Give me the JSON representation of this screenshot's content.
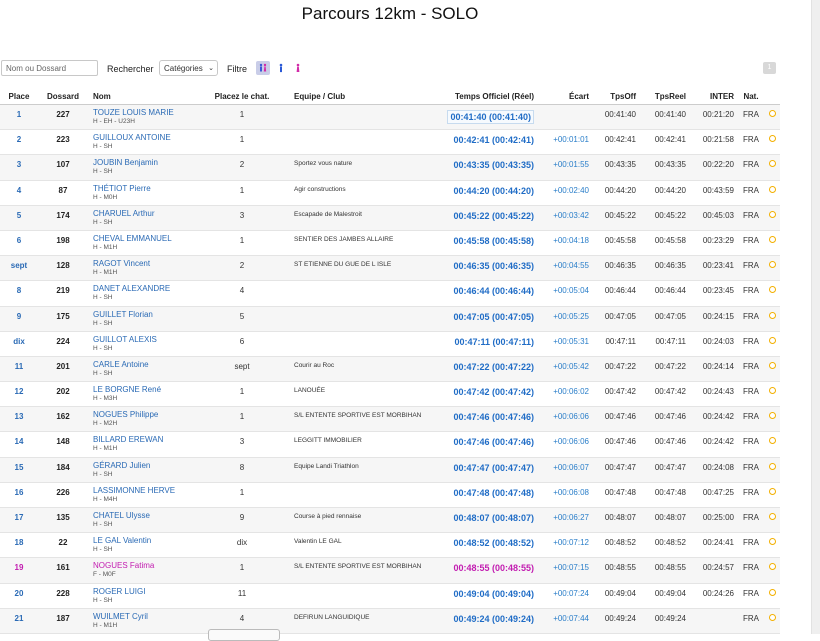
{
  "page_title": "Parcours 12km - SOLO",
  "toolbar": {
    "search_placeholder": "Nom ou Dossard",
    "search_button": "Rechercher",
    "categories_select": "Catégories",
    "filter_label": "Filtre",
    "filters": [
      "all-gender-icon",
      "male-icon",
      "female-icon"
    ],
    "page_number": "1"
  },
  "columns": [
    "Place",
    "Dossard",
    "Nom",
    "Placez le chat.",
    "Equipe / Club",
    "Temps Officiel (Réel)",
    "Écart",
    "TpsOff",
    "TpsReel",
    "INTER",
    "Nat."
  ],
  "rows": [
    {
      "place": "1",
      "dossard": "227",
      "nom": "TOUZE LOUIS MARIE",
      "cat": "H - EH - U23H",
      "cp": "1",
      "club": "",
      "temps": "00:41:40 (00:41:40)",
      "ecart": "",
      "tpsoff": "00:41:40",
      "tpsreel": "00:41:40",
      "inter": "00:21:20",
      "nat": "FRA",
      "gender": "M"
    },
    {
      "place": "2",
      "dossard": "223",
      "nom": "GUILLOUX ANTOINE",
      "cat": "H - SH",
      "cp": "1",
      "club": "",
      "temps": "00:42:41 (00:42:41)",
      "ecart": "+00:01:01",
      "tpsoff": "00:42:41",
      "tpsreel": "00:42:41",
      "inter": "00:21:58",
      "nat": "FRA",
      "gender": "M"
    },
    {
      "place": "3",
      "dossard": "107",
      "nom": "JOUBIN Benjamin",
      "cat": "H - SH",
      "cp": "2",
      "club": "Sportez vous nature",
      "temps": "00:43:35 (00:43:35)",
      "ecart": "+00:01:55",
      "tpsoff": "00:43:35",
      "tpsreel": "00:43:35",
      "inter": "00:22:20",
      "nat": "FRA",
      "gender": "M"
    },
    {
      "place": "4",
      "dossard": "87",
      "nom": "THÉTIOT Pierre",
      "cat": "H - M0H",
      "cp": "1",
      "club": "Agir constructions",
      "temps": "00:44:20 (00:44:20)",
      "ecart": "+00:02:40",
      "tpsoff": "00:44:20",
      "tpsreel": "00:44:20",
      "inter": "00:43:59",
      "nat": "FRA",
      "gender": "M"
    },
    {
      "place": "5",
      "dossard": "174",
      "nom": "CHARUEL Arthur",
      "cat": "H - SH",
      "cp": "3",
      "club": "Escapade de Malestroit",
      "temps": "00:45:22 (00:45:22)",
      "ecart": "+00:03:42",
      "tpsoff": "00:45:22",
      "tpsreel": "00:45:22",
      "inter": "00:45:03",
      "nat": "FRA",
      "gender": "M"
    },
    {
      "place": "6",
      "dossard": "198",
      "nom": "CHEVAL EMMANUEL",
      "cat": "H - M1H",
      "cp": "1",
      "club": "SENTIER DES JAMBES ALLAIRE",
      "temps": "00:45:58 (00:45:58)",
      "ecart": "+00:04:18",
      "tpsoff": "00:45:58",
      "tpsreel": "00:45:58",
      "inter": "00:23:29",
      "nat": "FRA",
      "gender": "M"
    },
    {
      "place": "sept",
      "dossard": "128",
      "nom": "RAGOT Vincent",
      "cat": "H - M1H",
      "cp": "2",
      "club": "ST ETIENNE DU GUE DE L ISLE",
      "temps": "00:46:35 (00:46:35)",
      "ecart": "+00:04:55",
      "tpsoff": "00:46:35",
      "tpsreel": "00:46:35",
      "inter": "00:23:41",
      "nat": "FRA",
      "gender": "M"
    },
    {
      "place": "8",
      "dossard": "219",
      "nom": "DANET ALEXANDRE",
      "cat": "H - SH",
      "cp": "4",
      "club": "",
      "temps": "00:46:44 (00:46:44)",
      "ecart": "+00:05:04",
      "tpsoff": "00:46:44",
      "tpsreel": "00:46:44",
      "inter": "00:23:45",
      "nat": "FRA",
      "gender": "M"
    },
    {
      "place": "9",
      "dossard": "175",
      "nom": "GUILLET Florian",
      "cat": "H - SH",
      "cp": "5",
      "club": "",
      "temps": "00:47:05 (00:47:05)",
      "ecart": "+00:05:25",
      "tpsoff": "00:47:05",
      "tpsreel": "00:47:05",
      "inter": "00:24:15",
      "nat": "FRA",
      "gender": "M"
    },
    {
      "place": "dix",
      "dossard": "224",
      "nom": "GUILLOT ALEXIS",
      "cat": "H - SH",
      "cp": "6",
      "club": "",
      "temps": "00:47:11 (00:47:11)",
      "ecart": "+00:05:31",
      "tpsoff": "00:47:11",
      "tpsreel": "00:47:11",
      "inter": "00:24:03",
      "nat": "FRA",
      "gender": "M"
    },
    {
      "place": "11",
      "dossard": "201",
      "nom": "CARLE Antoine",
      "cat": "H - SH",
      "cp": "sept",
      "club": "Courir au Roc",
      "temps": "00:47:22 (00:47:22)",
      "ecart": "+00:05:42",
      "tpsoff": "00:47:22",
      "tpsreel": "00:47:22",
      "inter": "00:24:14",
      "nat": "FRA",
      "gender": "M"
    },
    {
      "place": "12",
      "dossard": "202",
      "nom": "LE BORGNE René",
      "cat": "H - M3H",
      "cp": "1",
      "club": "LANOUÉE",
      "temps": "00:47:42 (00:47:42)",
      "ecart": "+00:06:02",
      "tpsoff": "00:47:42",
      "tpsreel": "00:47:42",
      "inter": "00:24:43",
      "nat": "FRA",
      "gender": "M"
    },
    {
      "place": "13",
      "dossard": "162",
      "nom": "NOGUES Philippe",
      "cat": "H - M2H",
      "cp": "1",
      "club": "S/L ENTENTE SPORTIVE EST MORBIHAN",
      "temps": "00:47:46 (00:47:46)",
      "ecart": "+00:06:06",
      "tpsoff": "00:47:46",
      "tpsreel": "00:47:46",
      "inter": "00:24:42",
      "nat": "FRA",
      "gender": "M"
    },
    {
      "place": "14",
      "dossard": "148",
      "nom": "BILLARD EREWAN",
      "cat": "H - M1H",
      "cp": "3",
      "club": "LEGGITT IMMOBILIER",
      "temps": "00:47:46 (00:47:46)",
      "ecart": "+00:06:06",
      "tpsoff": "00:47:46",
      "tpsreel": "00:47:46",
      "inter": "00:24:42",
      "nat": "FRA",
      "gender": "M"
    },
    {
      "place": "15",
      "dossard": "184",
      "nom": "GÉRARD Julien",
      "cat": "H - SH",
      "cp": "8",
      "club": "Equipe Landi Triathlon",
      "temps": "00:47:47 (00:47:47)",
      "ecart": "+00:06:07",
      "tpsoff": "00:47:47",
      "tpsreel": "00:47:47",
      "inter": "00:24:08",
      "nat": "FRA",
      "gender": "M"
    },
    {
      "place": "16",
      "dossard": "226",
      "nom": "LASSIMONNE HERVE",
      "cat": "H - M4H",
      "cp": "1",
      "club": "",
      "temps": "00:47:48 (00:47:48)",
      "ecart": "+00:06:08",
      "tpsoff": "00:47:48",
      "tpsreel": "00:47:48",
      "inter": "00:47:25",
      "nat": "FRA",
      "gender": "M"
    },
    {
      "place": "17",
      "dossard": "135",
      "nom": "CHATEL Ulysse",
      "cat": "H - SH",
      "cp": "9",
      "club": "Course à pied rennaise",
      "temps": "00:48:07 (00:48:07)",
      "ecart": "+00:06:27",
      "tpsoff": "00:48:07",
      "tpsreel": "00:48:07",
      "inter": "00:25:00",
      "nat": "FRA",
      "gender": "M"
    },
    {
      "place": "18",
      "dossard": "22",
      "nom": "LE GAL Valentin",
      "cat": "H - SH",
      "cp": "dix",
      "club": "Valentin LE GAL",
      "temps": "00:48:52 (00:48:52)",
      "ecart": "+00:07:12",
      "tpsoff": "00:48:52",
      "tpsreel": "00:48:52",
      "inter": "00:24:41",
      "nat": "FRA",
      "gender": "M"
    },
    {
      "place": "19",
      "dossard": "161",
      "nom": "NOGUES Fatima",
      "cat": "F - M0F",
      "cp": "1",
      "club": "S/L ENTENTE SPORTIVE EST MORBIHAN",
      "temps": "00:48:55 (00:48:55)",
      "ecart": "+00:07:15",
      "tpsoff": "00:48:55",
      "tpsreel": "00:48:55",
      "inter": "00:24:57",
      "nat": "FRA",
      "gender": "F"
    },
    {
      "place": "20",
      "dossard": "228",
      "nom": "ROGER LUIGI",
      "cat": "H - SH",
      "cp": "11",
      "club": "",
      "temps": "00:49:04 (00:49:04)",
      "ecart": "+00:07:24",
      "tpsoff": "00:49:04",
      "tpsreel": "00:49:04",
      "inter": "00:24:26",
      "nat": "FRA",
      "gender": "M"
    },
    {
      "place": "21",
      "dossard": "187",
      "nom": "WUILMET Cyril",
      "cat": "H - M1H",
      "cp": "4",
      "club": "DEFIRUN LANGUIDIQUE",
      "temps": "00:49:24 (00:49:24)",
      "ecart": "+00:07:44",
      "tpsoff": "00:49:24",
      "tpsreel": "00:49:24",
      "inter": "",
      "nat": "FRA",
      "gender": "M"
    }
  ]
}
